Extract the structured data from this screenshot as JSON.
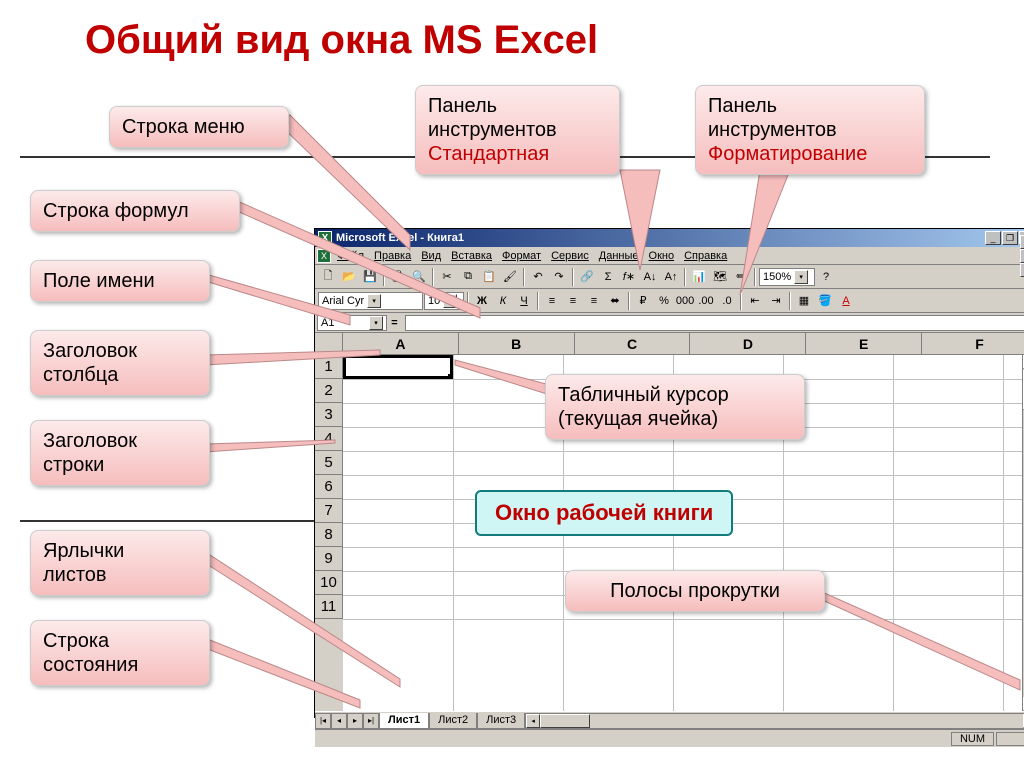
{
  "title": "Общий вид окна MS Excel",
  "callouts": {
    "menu_row": "Строка меню",
    "std_toolbar_1": "Панель",
    "std_toolbar_2": "инструментов",
    "std_toolbar_3": "Стандартная",
    "fmt_toolbar_1": "Панель",
    "fmt_toolbar_2": "инструментов",
    "fmt_toolbar_3": "Форматирование",
    "formula_row": "Строка формул",
    "name_box": "Поле имени",
    "col_header_1": "Заголовок",
    "col_header_2": "столбца",
    "row_header_1": "Заголовок",
    "row_header_2": "строки",
    "sheet_tabs_1": "Ярлычки",
    "sheet_tabs_2": "листов",
    "status_row_1": "Строка",
    "status_row_2": "состояния",
    "cursor_1": "Табличный курсор",
    "cursor_2": "(текущая ячейка)",
    "workbook": "Окно рабочей книги",
    "scrollbars": "Полосы прокрутки"
  },
  "excel": {
    "title": "Microsoft Excel - Книга1",
    "menu": [
      "Файл",
      "Правка",
      "Вид",
      "Вставка",
      "Формат",
      "Сервис",
      "Данные",
      "Окно",
      "Справка"
    ],
    "font": "Arial Cyr",
    "fontsize": "10",
    "zoom": "150%",
    "namebox": "A1",
    "columns": [
      "A",
      "B",
      "C",
      "D",
      "E",
      "F"
    ],
    "rows": [
      "1",
      "2",
      "3",
      "4",
      "5",
      "6",
      "7",
      "8",
      "9",
      "10",
      "11"
    ],
    "tabs": [
      "Лист1",
      "Лист2",
      "Лист3"
    ],
    "status_num": "NUM"
  }
}
